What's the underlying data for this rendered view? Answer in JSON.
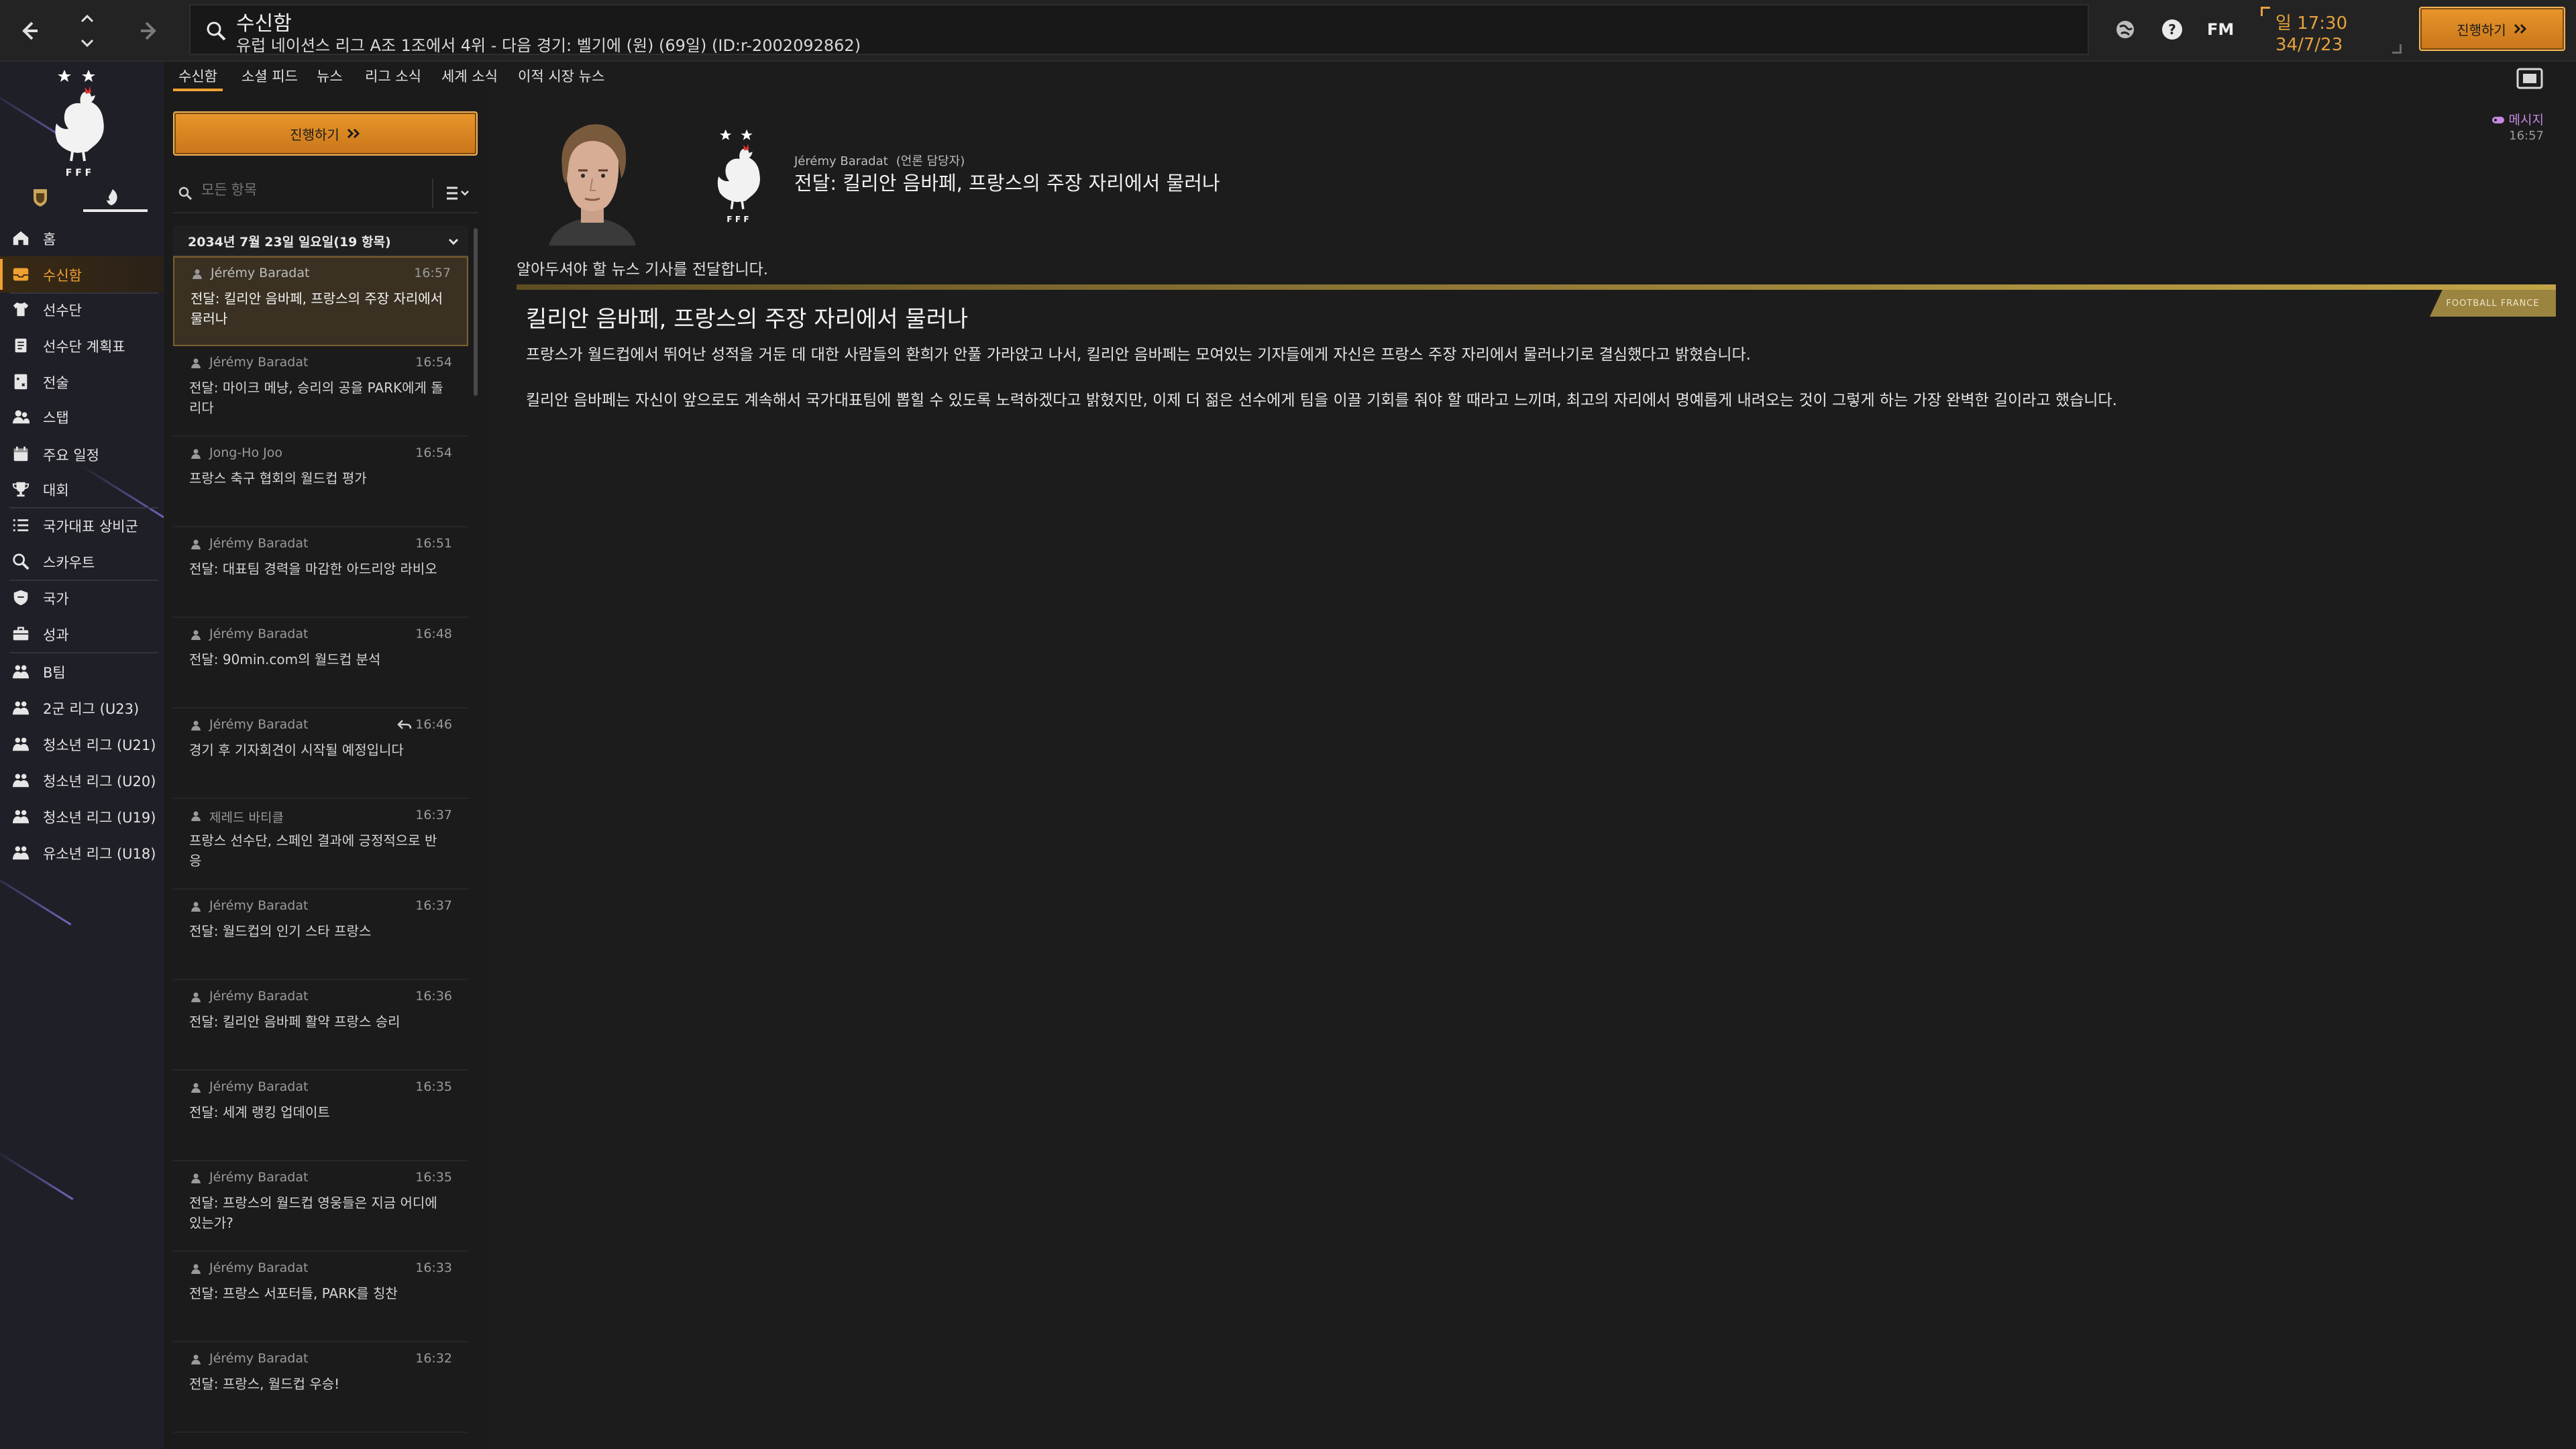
{
  "header": {
    "title": "수신함",
    "subtitle": "유럽 네이션스 리그 A조 1조에서 4위 - 다음 경기: 벨기에 (원) (69일) (ID:r-2002092862)",
    "fm_label": "FM",
    "time": "일 17:30",
    "date": "34/7/23",
    "continue_label": "진행하기"
  },
  "nav": {
    "items": [
      {
        "label": "홈",
        "icon": "home-icon"
      },
      {
        "label": "수신함",
        "icon": "inbox-icon",
        "active": true
      },
      {
        "label": "선수단",
        "icon": "shirt-icon"
      },
      {
        "label": "선수단 계획표",
        "icon": "clipboard-icon"
      },
      {
        "label": "전술",
        "icon": "tactics-board-icon"
      },
      {
        "label": "스탭",
        "icon": "staff-icon"
      },
      {
        "label": "주요 일정",
        "icon": "calendar-icon"
      },
      {
        "label": "대회",
        "icon": "trophy-icon"
      },
      {
        "label": "국가대표 상비군",
        "icon": "list-icon"
      },
      {
        "label": "스카우트",
        "icon": "magnifier-icon"
      },
      {
        "label": "국가",
        "icon": "shield-icon"
      },
      {
        "label": "성과",
        "icon": "briefcase-icon"
      },
      {
        "label": "B팀",
        "icon": "team-icon"
      },
      {
        "label": "2군 리그 (U23)",
        "icon": "team-icon"
      },
      {
        "label": "청소년 리그 (U21)",
        "icon": "team-icon"
      },
      {
        "label": "청소년 리그 (U20)",
        "icon": "team-icon"
      },
      {
        "label": "청소년 리그 (U19)",
        "icon": "team-icon"
      },
      {
        "label": "유소년 리그 (U18)",
        "icon": "team-icon"
      }
    ]
  },
  "tabs": [
    "수신함",
    "소셜 피드",
    "뉴스",
    "리그 소식",
    "세계 소식",
    "이적 시장 뉴스"
  ],
  "inbox": {
    "continue_label": "진행하기",
    "filter_placeholder": "모든 항목",
    "date_header": "2034년 7월 23일 일요일(19 항목)",
    "messages": [
      {
        "from": "Jérémy Baradat",
        "time": "16:57",
        "subject": "전달: 킬리안 음바페, 프랑스의 주장 자리에서 물러나",
        "active": true
      },
      {
        "from": "Jérémy Baradat",
        "time": "16:54",
        "subject": "전달: 마이크 메냥, 승리의 공을 PARK에게 돌리다"
      },
      {
        "from": "Jong-Ho Joo",
        "time": "16:54",
        "subject": "프랑스 축구 협회의 월드컵 평가"
      },
      {
        "from": "Jérémy Baradat",
        "time": "16:51",
        "subject": "전달: 대표팀 경력을 마감한 아드리앙 라비오"
      },
      {
        "from": "Jérémy Baradat",
        "time": "16:48",
        "subject": "전달: 90min.com의 월드컵 분석"
      },
      {
        "from": "Jérémy Baradat",
        "time": "16:46",
        "subject": "경기 후 기자회견이 시작될 예정입니다",
        "reply": true
      },
      {
        "from": "제레드 바티클",
        "time": "16:37",
        "subject": "프랑스 선수단, 스페인 결과에 긍정적으로 반응"
      },
      {
        "from": "Jérémy Baradat",
        "time": "16:37",
        "subject": "전달: 월드컵의 인기 스타 프랑스"
      },
      {
        "from": "Jérémy Baradat",
        "time": "16:36",
        "subject": "전달: 킬리안 음바페 활약 프랑스 승리"
      },
      {
        "from": "Jérémy Baradat",
        "time": "16:35",
        "subject": "전달: 세계 랭킹 업데이트"
      },
      {
        "from": "Jérémy Baradat",
        "time": "16:35",
        "subject": "전달: 프랑스의 월드컵 영웅들은 지금 어디에 있는가?"
      },
      {
        "from": "Jérémy Baradat",
        "time": "16:33",
        "subject": "전달: 프랑스 서포터들, PARK를 칭찬"
      },
      {
        "from": "Jérémy Baradat",
        "time": "16:32",
        "subject": "전달: 프랑스, 월드컵 우승!"
      }
    ]
  },
  "detail": {
    "sender": "Jérémy Baradat",
    "sender_role": "(언론 담당자)",
    "subject": "전달: 킬리안 음바페, 프랑스의 주장 자리에서 물러나",
    "tag": "메시지",
    "time": "16:57",
    "intro": "알아두셔야 할 뉴스 기사를 전달합니다.",
    "source": "FOOTBALL FRANCE",
    "article_title": "킬리안 음바페, 프랑스의 주장 자리에서 물러나",
    "paragraphs": [
      "프랑스가 월드컵에서 뛰어난 성적을 거둔 데 대한 사람들의 환희가 안풀 가라앉고 나서, 킬리안 음바페는 모여있는 기자들에게 자신은 프랑스 주장 자리에서 물러나기로 결심했다고 밝혔습니다.",
      "킬리안 음바페는 자신이 앞으로도 계속해서 국가대표팀에 뽑힐 수 있도록 노력하겠다고 밝혔지만, 이제 더 젊은 선수에게 팀을 이끌 기회를 줘야 할 때라고 느끼며, 최고의 자리에서 명예롭게 내려오는 것이 그렇게 하는 가장 완벽한 길이라고 했습니다."
    ]
  },
  "colors": {
    "accent": "#f0a030",
    "background": "#1c1c1c",
    "panel": "#1b1b1b",
    "nav": "#1f1f27",
    "tag": "#c58ae0",
    "gold_bar": "#c2a447"
  }
}
